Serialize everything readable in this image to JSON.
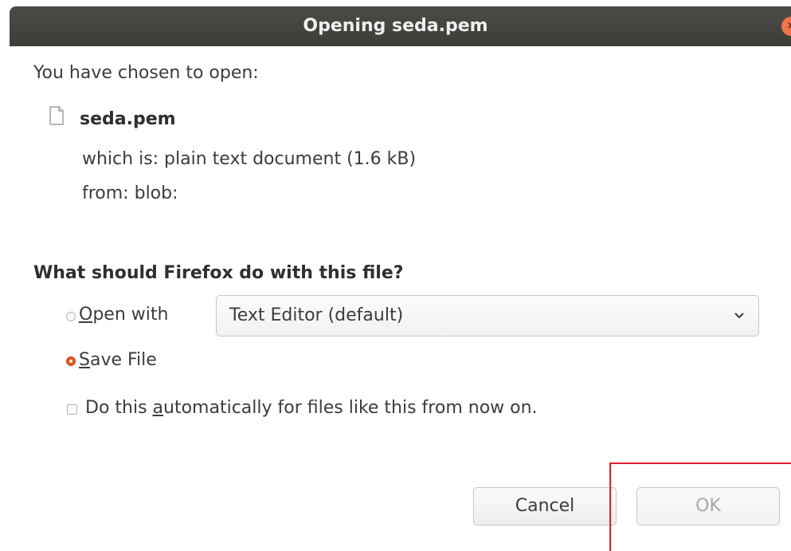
{
  "window": {
    "title": "Opening seda.pem",
    "close_glyph": "×"
  },
  "dialog": {
    "chosen_text": "You have chosen to open:",
    "file_icon": "text-file-icon",
    "filename": "seda.pem",
    "which_is": "which is: plain text document (1.6 kB)",
    "from": "from: blob:",
    "question": "What should Firefox do with this file?",
    "open_with": {
      "label_mnemonic": "O",
      "label_rest": "pen with",
      "selected": false,
      "app": "Text Editor (default)"
    },
    "save_file": {
      "label_mnemonic": "S",
      "label_rest": "ave File",
      "selected": true
    },
    "auto": {
      "label_pre": "Do this ",
      "label_mnemonic": "a",
      "label_post": "utomatically for files like this from now on.",
      "checked": false
    },
    "buttons": {
      "cancel": "Cancel",
      "ok": "OK"
    }
  },
  "colors": {
    "accent": "#e95420",
    "titlebar": "#45433f",
    "highlight": "#e0202a"
  }
}
